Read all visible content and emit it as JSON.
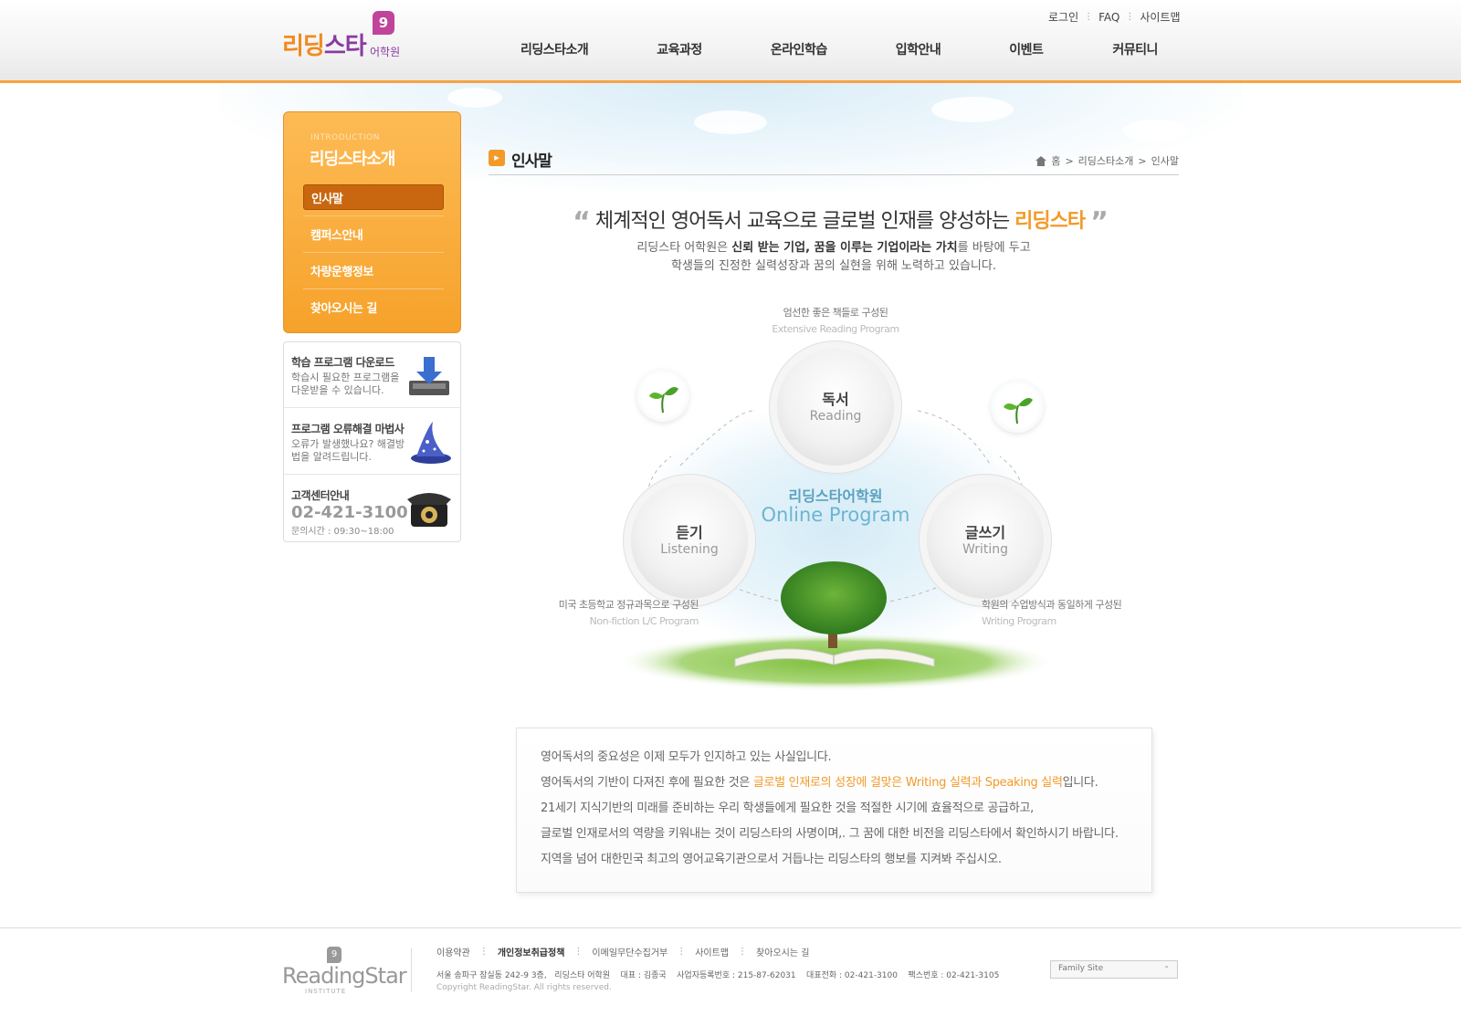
{
  "header": {
    "logo_text_1": "리딩",
    "logo_text_2": "스타",
    "logo_badge": "9",
    "logo_sub": "어학원",
    "util": [
      "로그인",
      "FAQ",
      "사이트맵"
    ],
    "util_sep": "⋮",
    "gnb": [
      "리딩스타소개",
      "교육과정",
      "온라인학습",
      "입학안내",
      "이벤트",
      "커뮤티니"
    ]
  },
  "lnb": {
    "en": "INTRODUCTION",
    "title": "리딩스타소개",
    "items": [
      "인사말",
      "캠퍼스안내",
      "차량운행정보",
      "찾아오시는 길"
    ],
    "active_index": 0
  },
  "side": {
    "download": {
      "title": "학습 프로그램 다운로드",
      "desc": "학습시 필요한 프로그램을 다운받을 수 있습니다."
    },
    "wizard": {
      "title": "프로그램 오류해결 마법사",
      "desc": "오류가 발생했나요? 해결방법을 알려드립니다."
    },
    "center": {
      "title": "고객센터안내",
      "tel": "02-421-3100",
      "hours": "문의시간 : 09:30~18:00"
    }
  },
  "content": {
    "title": "인사말",
    "crumbs": [
      "홈",
      "리딩스타소개",
      "인사말"
    ],
    "crumb_sep": ">",
    "headline_pre": "체계적인 영어독서 교육으로 글로벌 인재를 양성하는",
    "headline_hl": "리딩스타",
    "lead_1a": "리딩스타 어학원은",
    "lead_1b": "신뢰 받는 기업, 꿈을 이루는 기업이라는 가치",
    "lead_1c": "를 바탕에 두고",
    "lead_2": "학생들의 진정한 실력성장과 꿈의 실현을 위해 노력하고 있습니다."
  },
  "diagram": {
    "center_kr": "리딩스타어학원",
    "center_en": "Online Program",
    "reading": {
      "kr": "독서",
      "en": "Reading",
      "label_kr": "엄선한 좋은 책들로 구성된",
      "label_en": "Extensive Reading Program"
    },
    "listening": {
      "kr": "듣기",
      "en": "Listening",
      "label_kr": "미국 초등학교 정규과목으로 구성된",
      "label_en": "Non-fiction L/C Program"
    },
    "writing": {
      "kr": "글쓰기",
      "en": "Writing",
      "label_kr": "학원의 수업방식과 동일하게 구성된",
      "label_en": "Writing Program"
    }
  },
  "message": {
    "line1": "영어독서의 중요성은 이제 모두가 인지하고 있는 사실입니다.",
    "line2_pre": "영어독서의 기반이 다져진 후에 필요한 것은 ",
    "line2_hl": "글로벌 인재로의 성장에 걸맞은 Writing 실력과 Speaking 실력",
    "line2_post": "입니다.",
    "line3": "21세기 지식기반의 미래를 준비하는 우리 학생들에게 필요한 것을 적절한 시기에 효율적으로 공급하고,",
    "line4": "글로벌 인재로서의 역량을 키워내는 것이 리딩스타의 사명이며,. 그 꿈에 대한 비전을 리딩스타에서 확인하시기 바랍니다.",
    "line5": "지역을 넘어 대한민국 최고의 영어교육기관으로서 거듭나는 리딩스타의 행보를 지켜봐 주십시오."
  },
  "footer": {
    "logo": "ReadingStar",
    "logo_badge": "9",
    "logo_sub": "INSTITUTE",
    "links": [
      "이용약관",
      "개인정보취급정책",
      "이메일무단수집거부",
      "사이트맵",
      "찾아오시는 길"
    ],
    "link_sep": "⋮",
    "info": "서울 송파구 잠실동 242-9 3층,   리딩스타 어학원    대표 : 김종국    사업자등록번호 : 215-87-62031    대표전화 : 02-421-3100    팩스번호 : 02-421-3105",
    "copyright": "Copyright ReadingStar. All rights reserved.",
    "family": "Family Site"
  },
  "colors": {
    "accent": "#f39a28",
    "lnb": "#f6a22b",
    "online": "#6db4d2"
  }
}
